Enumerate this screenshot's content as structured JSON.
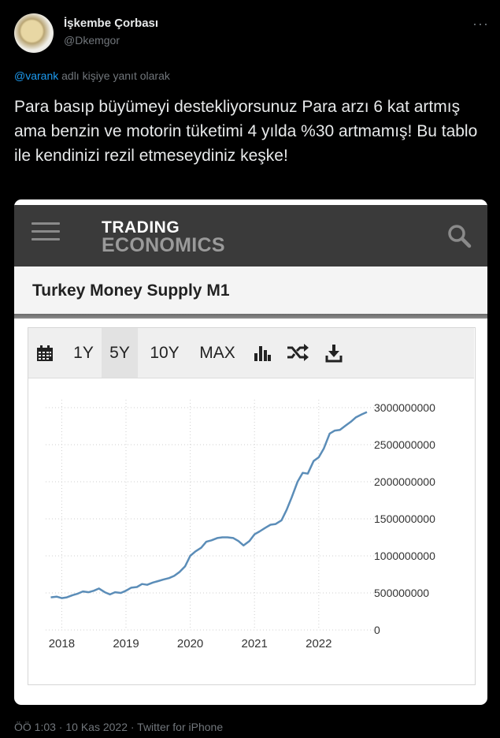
{
  "author": {
    "name": "İşkembe Çorbası",
    "handle": "@Dkemgor"
  },
  "more_label": "···",
  "reply_context": {
    "mention": "@varank",
    "text": " adlı kişiye yanıt olarak"
  },
  "tweet_text": "Para basıp büyümeyi destekliyorsunuz Para arzı 6 kat artmış ama benzin ve motorin tüketimi 4 yılda %30 artmamış! Bu tablo ile  kendinizi  rezil etmeseydiniz keşke!",
  "card": {
    "logo_line1": "TRADING",
    "logo_line2": "ECONOMICS",
    "title": "Turkey Money Supply M1",
    "toolbar": {
      "ranges": [
        "1Y",
        "5Y",
        "10Y",
        "MAX"
      ],
      "active_range": "5Y",
      "icons": [
        "calendar-icon",
        "bar-chart-icon",
        "shuffle-icon",
        "download-icon"
      ]
    }
  },
  "chart_data": {
    "type": "line",
    "title": "",
    "xlabel": "",
    "ylabel": "",
    "x_ticks": [
      "2018",
      "2019",
      "2020",
      "2021",
      "2022"
    ],
    "y_ticks": [
      "3000000000",
      "2500000000",
      "2000000000",
      "1500000000",
      "1000000000",
      "500000000",
      "0"
    ],
    "ylim": [
      0,
      3000000000
    ],
    "xlim": [
      2017.75,
      2022.75
    ],
    "grid": "vertical-dotted",
    "series": [
      {
        "color": "#5b8db8",
        "x": [
          2017.83,
          2017.92,
          2018.0,
          2018.08,
          2018.17,
          2018.25,
          2018.33,
          2018.42,
          2018.5,
          2018.58,
          2018.67,
          2018.75,
          2018.83,
          2018.92,
          2019.0,
          2019.08,
          2019.17,
          2019.25,
          2019.33,
          2019.42,
          2019.5,
          2019.58,
          2019.67,
          2019.75,
          2019.83,
          2019.92,
          2020.0,
          2020.08,
          2020.17,
          2020.25,
          2020.33,
          2020.42,
          2020.5,
          2020.58,
          2020.67,
          2020.75,
          2020.83,
          2020.92,
          2021.0,
          2021.08,
          2021.17,
          2021.25,
          2021.33,
          2021.42,
          2021.5,
          2021.58,
          2021.67,
          2021.75,
          2021.83,
          2021.92,
          2022.0,
          2022.08,
          2022.17,
          2022.25,
          2022.33,
          2022.42,
          2022.5,
          2022.58,
          2022.67,
          2022.75
        ],
        "values": [
          440000000,
          450000000,
          430000000,
          440000000,
          470000000,
          490000000,
          520000000,
          510000000,
          530000000,
          560000000,
          510000000,
          480000000,
          510000000,
          500000000,
          530000000,
          570000000,
          580000000,
          620000000,
          610000000,
          640000000,
          660000000,
          680000000,
          700000000,
          730000000,
          780000000,
          860000000,
          1000000000,
          1060000000,
          1110000000,
          1190000000,
          1210000000,
          1240000000,
          1250000000,
          1250000000,
          1240000000,
          1200000000,
          1140000000,
          1200000000,
          1290000000,
          1330000000,
          1380000000,
          1420000000,
          1430000000,
          1480000000,
          1620000000,
          1790000000,
          2000000000,
          2120000000,
          2110000000,
          2280000000,
          2330000000,
          2450000000,
          2650000000,
          2690000000,
          2700000000,
          2760000000,
          2810000000,
          2870000000,
          2910000000,
          2940000000
        ]
      }
    ]
  },
  "footer": "ÖÖ 1:03 · 10 Kas 2022 · Twitter for iPhone"
}
